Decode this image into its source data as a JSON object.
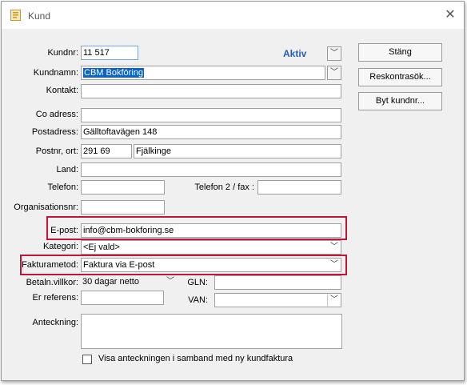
{
  "window": {
    "title": "Kund"
  },
  "status": {
    "text": "Aktiv",
    "color": "#1f5fbf"
  },
  "buttons": {
    "close": "Stäng",
    "ledger": "Reskontrasök...",
    "change_number": "Byt kundnr..."
  },
  "fields": {
    "customer_number": {
      "label": "Kundnr:",
      "value": "11 517"
    },
    "customer_name": {
      "label": "Kundnamn:",
      "value": "CBM Bokföring"
    },
    "contact": {
      "label": "Kontakt:",
      "value": ""
    },
    "co_address": {
      "label": "Co adress:",
      "value": ""
    },
    "postal_address": {
      "label": "Postadress:",
      "value": "Gälltoftavägen 148"
    },
    "postcode_city": {
      "label": "Postnr, ort:",
      "postcode": "291 69",
      "city": "Fjälkinge"
    },
    "country": {
      "label": "Land:",
      "value": ""
    },
    "phone": {
      "label": "Telefon:",
      "value": ""
    },
    "phone2_fax": {
      "label": "Telefon 2 / fax :",
      "value": ""
    },
    "org_number": {
      "label": "Organisationsnr:",
      "value": ""
    },
    "email": {
      "label": "E-post:",
      "value": "info@cbm-bokforing.se"
    },
    "category": {
      "label": "Kategori:",
      "value": "<Ej vald>"
    },
    "invoice_method": {
      "label": "Fakturametod:",
      "value": "Faktura via E-post"
    },
    "payment_terms": {
      "label": "Betaln.villkor:",
      "value": "30 dagar netto"
    },
    "gln": {
      "label": "GLN:",
      "value": ""
    },
    "reference": {
      "label": "Er referens:",
      "value": ""
    },
    "van": {
      "label": "VAN:",
      "value": ""
    },
    "note": {
      "label": "Anteckning:",
      "value": ""
    }
  },
  "checkbox": {
    "label": "Visa anteckningen i samband med ny kundfaktura",
    "checked": false
  },
  "icons": {
    "app": "customer-card-icon",
    "close": "close-icon",
    "dropdown": "chevron-down-icon"
  },
  "highlight_color": "#c3143a"
}
